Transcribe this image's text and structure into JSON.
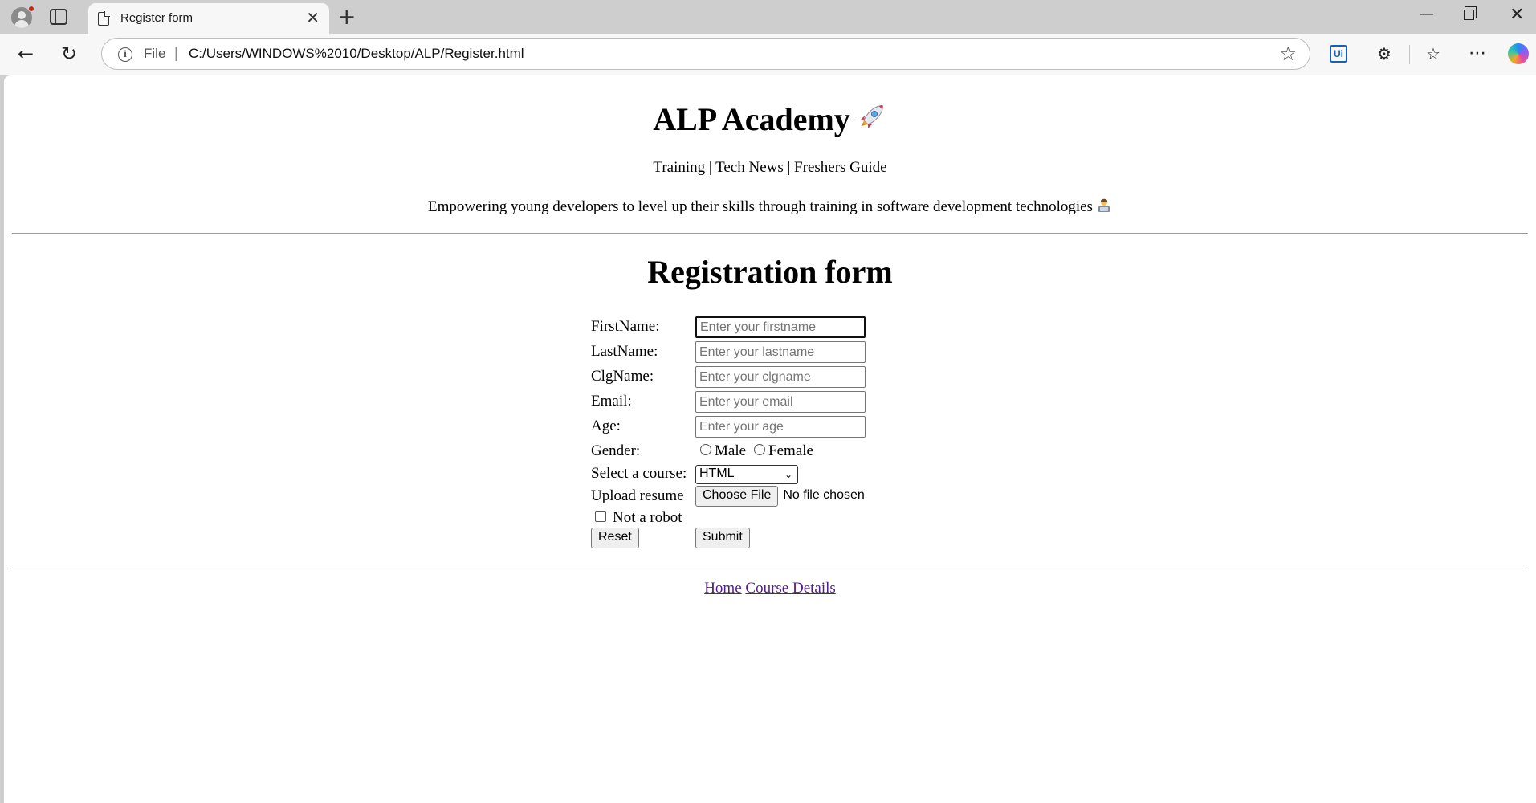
{
  "browser": {
    "tab_title": "Register form",
    "address_prefix": "File",
    "address_separator": "|",
    "url": "C:/Users/WINDOWS%2010/Desktop/ALP/Register.html"
  },
  "header": {
    "brand": "ALP Academy",
    "nav": "Training | Tech News | Freshers Guide",
    "tagline": "Empowering young developers to level up their skills through training in software development technologies"
  },
  "form": {
    "title": "Registration form",
    "fields": {
      "firstname": {
        "label": "FirstName:",
        "placeholder": "Enter your firstname"
      },
      "lastname": {
        "label": "LastName:",
        "placeholder": "Enter your lastname"
      },
      "clgname": {
        "label": "ClgName:",
        "placeholder": "Enter your clgname"
      },
      "email": {
        "label": "Email:",
        "placeholder": "Enter your email"
      },
      "age": {
        "label": "Age:",
        "placeholder": "Enter your age"
      }
    },
    "gender": {
      "label": "Gender:",
      "male": "Male",
      "female": "Female"
    },
    "course": {
      "label": "Select a course:",
      "selected": "HTML"
    },
    "resume": {
      "label": "Upload resume",
      "button": "Choose File",
      "status": "No file chosen"
    },
    "robot": {
      "label": "Not a robot"
    },
    "reset_label": "Reset",
    "submit_label": "Submit"
  },
  "footer": {
    "home": "Home",
    "course_details": "Course Details"
  },
  "icons": {
    "brand_emoji": "rocket-icon",
    "tagline_emoji": "technologist-icon"
  }
}
